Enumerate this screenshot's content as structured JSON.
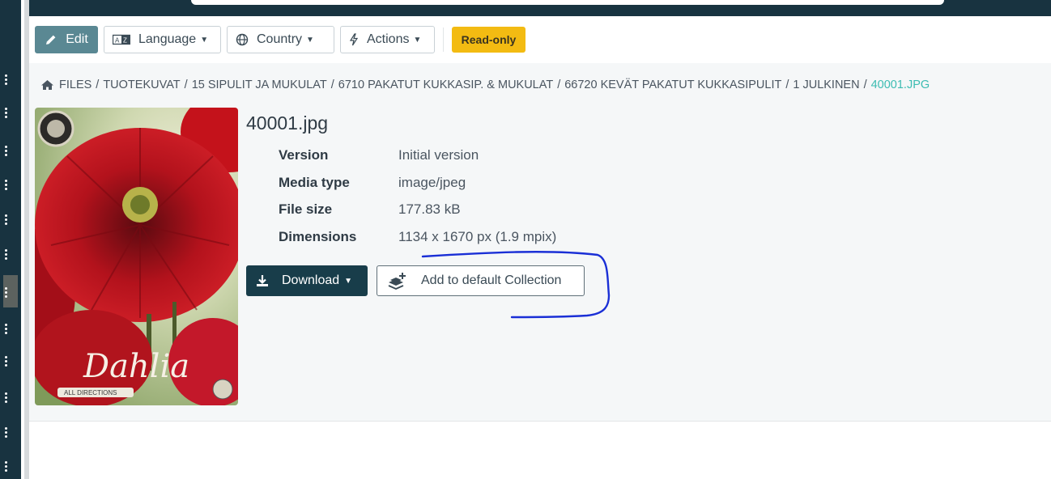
{
  "toolbar": {
    "edit_label": "Edit",
    "language_label": "Language",
    "country_label": "Country",
    "actions_label": "Actions",
    "readonly_badge": "Read-only"
  },
  "breadcrumb": {
    "items": [
      "FILES",
      "TUOTEKUVAT",
      "15 SIPULIT JA MUKULAT",
      "6710 PAKATUT KUKKASIP. & MUKULAT",
      "66720 KEVÄT PAKATUT KUKKASIPULIT",
      "1 JULKINEN"
    ],
    "current": "40001.JPG",
    "separator": "/"
  },
  "file": {
    "title": "40001.jpg",
    "thumbnail": {
      "script_text": "Dahlia",
      "footer_text": "ALL DIRECTIONS"
    },
    "meta": [
      {
        "key": "Version",
        "value": "Initial version"
      },
      {
        "key": "Media type",
        "value": "image/jpeg"
      },
      {
        "key": "File size",
        "value": "177.83 kB"
      },
      {
        "key": "Dimensions",
        "value": "1134 x 1670 px (1.9 mpix)"
      }
    ]
  },
  "actions": {
    "download_label": "Download",
    "collection_label": "Add to default Collection"
  },
  "colors": {
    "nav_dark": "#183340",
    "edit_button": "#5a8893",
    "readonly_badge": "#f3bb12",
    "download_button": "#183d4a",
    "breadcrumb_current": "#3cbcb2",
    "annotation_ink": "#1a2fd6"
  },
  "icons": {
    "edit": "pencil-icon",
    "language": "language-icon",
    "country": "globe-icon",
    "actions": "bolt-icon",
    "home": "home-icon",
    "download": "download-icon",
    "collection": "layers-plus-icon"
  }
}
